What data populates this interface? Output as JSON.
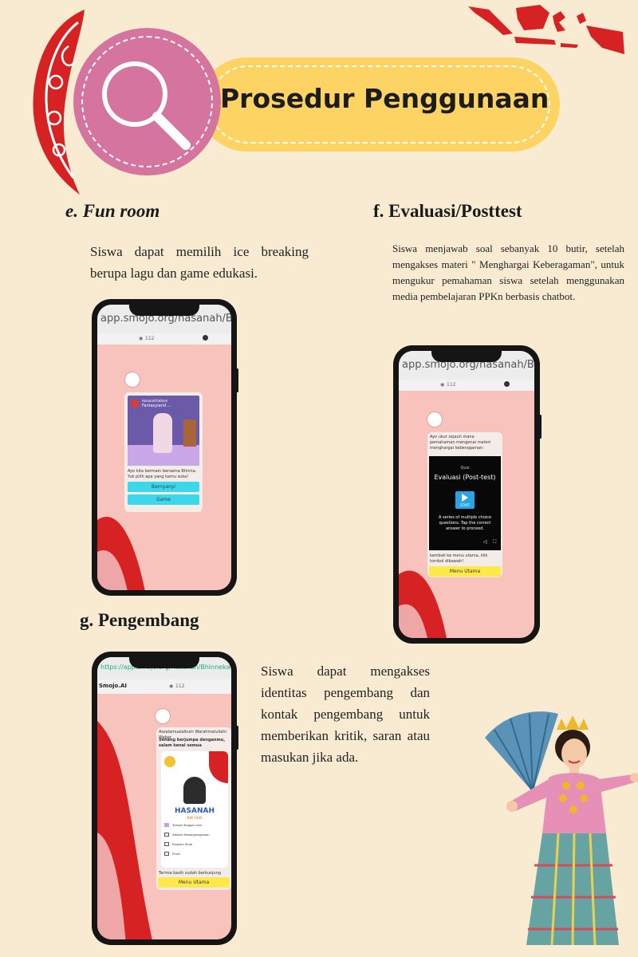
{
  "header": {
    "title": "Prosedur  Penggunaan"
  },
  "sections": {
    "e": {
      "heading": "e. Fun room",
      "text": "Siswa dapat memilih ice breaking berupa lagu dan game edukasi."
    },
    "f": {
      "heading": "f. Evaluasi/Posttest",
      "text": "Siswa menjawab soal sebanyak 10 butir, setelah mengakses materi \" Menghargai Keberagaman\", untuk mengukur pemahaman siswa setelah menggunakan media pembelajaran PPKn berbasis chatbot."
    },
    "g": {
      "heading": "g. Pengembang",
      "text": "Siswa dapat mengakses identitas pengembang dan kontak pengembang untuk memberikan kritik, saran atau masukan jika ada."
    }
  },
  "phone_e": {
    "url": "app.smojo.org/hasanah/Bhinneka",
    "views": "112",
    "video_channel": "HasanahFathiah",
    "video_title": "Fantasyland ...",
    "message": "Ayo kita bermain bersama Bhinna. Yuk pilih apa yang kamu suka!",
    "buttons": [
      "Bernyanyi",
      "Game"
    ]
  },
  "phone_f": {
    "url": "app.smojo.org/hasanah/Bhinneka",
    "views": "112",
    "intro": "Ayo ukur sejauh mana pemahaman mengenai materi menghargai keberagaman:",
    "quiz_label": "Quiz",
    "quiz_title": "Evaluasi (Post-test)",
    "start_label": "START",
    "quiz_desc": "A series of multiple choice questions. Tap the correct answer to proceed.",
    "back_text": "kembali ke menu utama, klik tombol dibawah!",
    "menu_btn": "Menu Utama"
  },
  "phone_g": {
    "url": "https://app.smojo.org/hasanah/Bhinneka",
    "brand": "Smojo.AI",
    "views": "112",
    "greeting": "Assalamualaikum Warahmatullahi Wabar",
    "intro": "Senang berjumpa denganmu, salam kenal semua",
    "name": "HASANAH",
    "nim": "NIM 1906",
    "detail_lines": [
      "Tempat Tanggal Lahir",
      "Sekolah Kewarganegaraan",
      "Program Studi",
      "Email"
    ],
    "thanks": "Terima kasih sudah berkunjung",
    "menu_btn": "Menu Utama"
  }
}
